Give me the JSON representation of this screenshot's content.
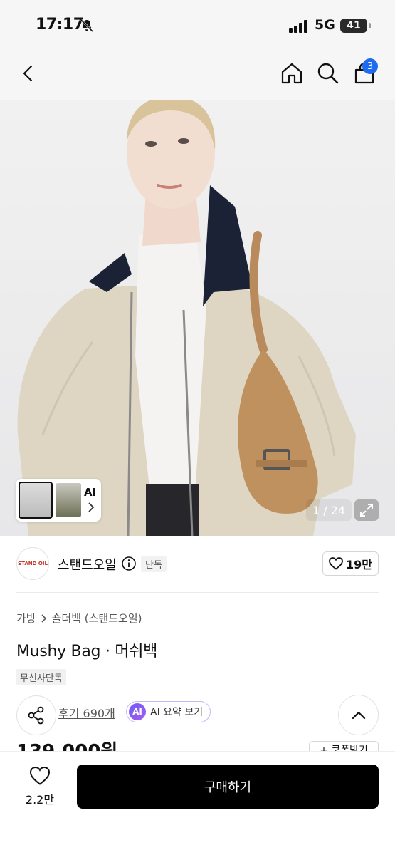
{
  "status_bar": {
    "time": "17:17",
    "network": "5G",
    "battery": "41"
  },
  "nav": {
    "cart_count": "3"
  },
  "gallery": {
    "thumb_label": "AI",
    "page_indicator": "1 / 24"
  },
  "brand": {
    "logo_text": "STAND OIL",
    "name": "스탠드오일",
    "exclusive_tag": "단독",
    "likes": "19만"
  },
  "breadcrumb": {
    "category": "가방",
    "subcategory": "숄더백 (스탠드오일)"
  },
  "product": {
    "title": "Mushy Bag · 머쉬백",
    "store_badge": "무신사단독",
    "review_text": "후기 690개",
    "ai_label": "AI",
    "ai_summary": "AI 요약 보기",
    "price": "139,000원",
    "coupon": "+ 쿠폰받기"
  },
  "bottom_bar": {
    "wish_count": "2.2만",
    "buy_label": "구매하기"
  }
}
